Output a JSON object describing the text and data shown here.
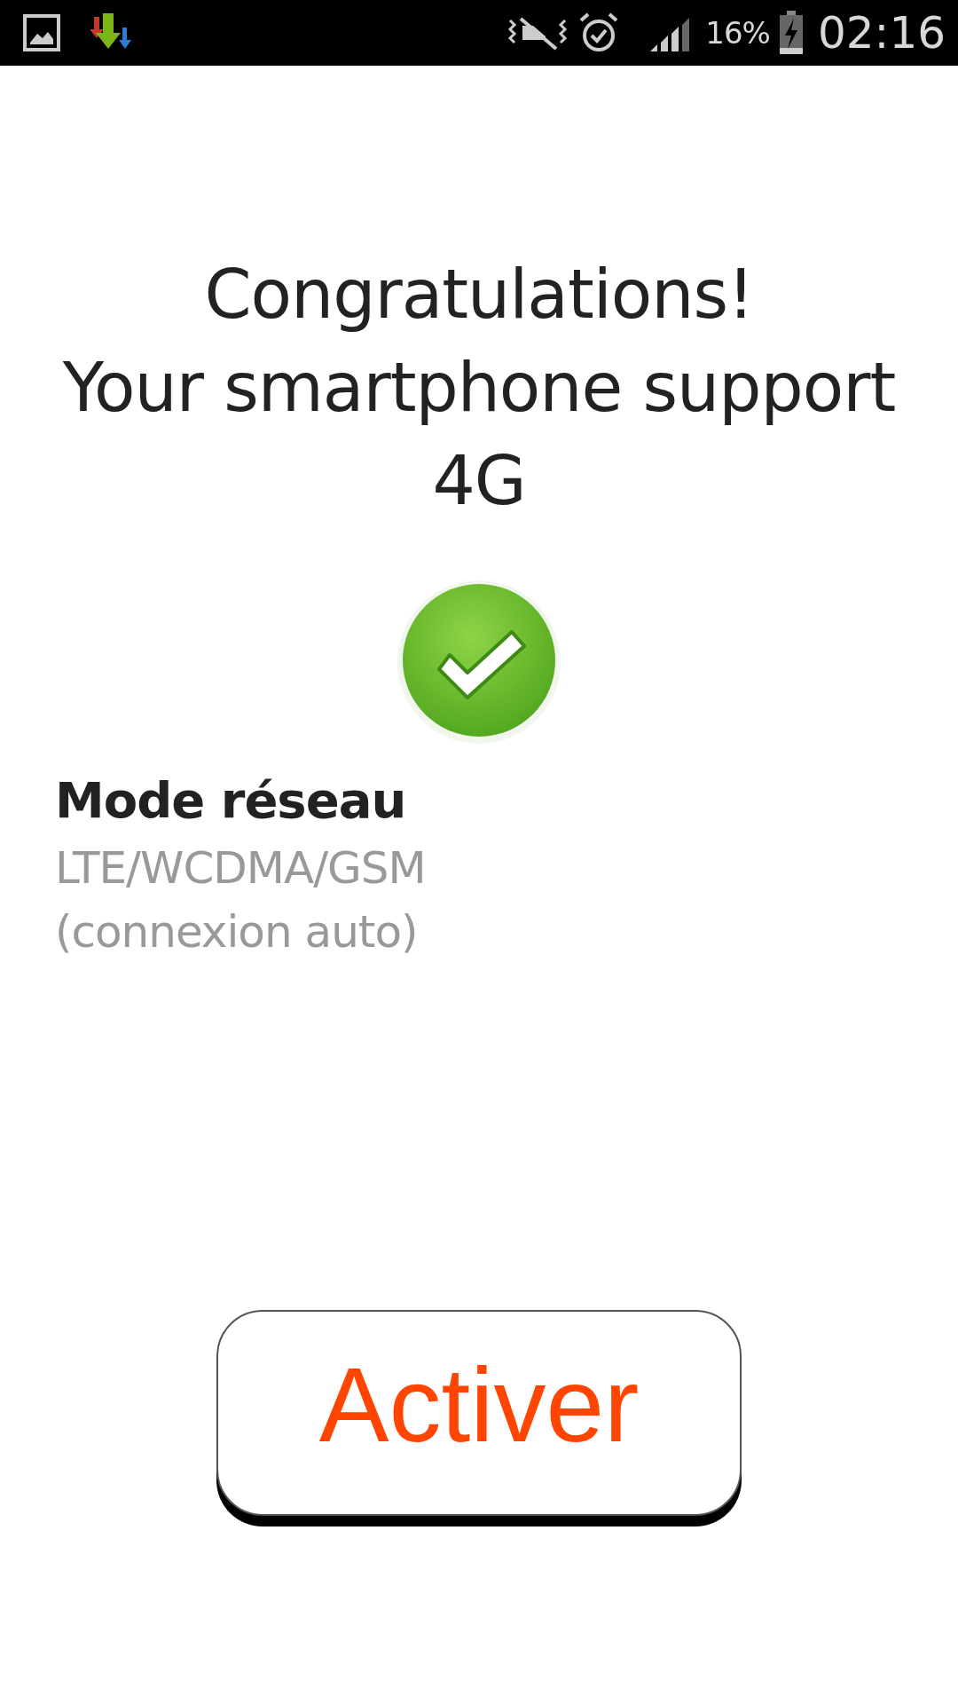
{
  "status_bar": {
    "battery_percent": "16%",
    "time": "02:16"
  },
  "heading": "Congratulations!",
  "message": "Your smartphone support 4G",
  "setting": {
    "label": "Mode réseau",
    "value": "LTE/WCDMA/GSM (connexion auto)"
  },
  "button": {
    "label": "Activer"
  }
}
